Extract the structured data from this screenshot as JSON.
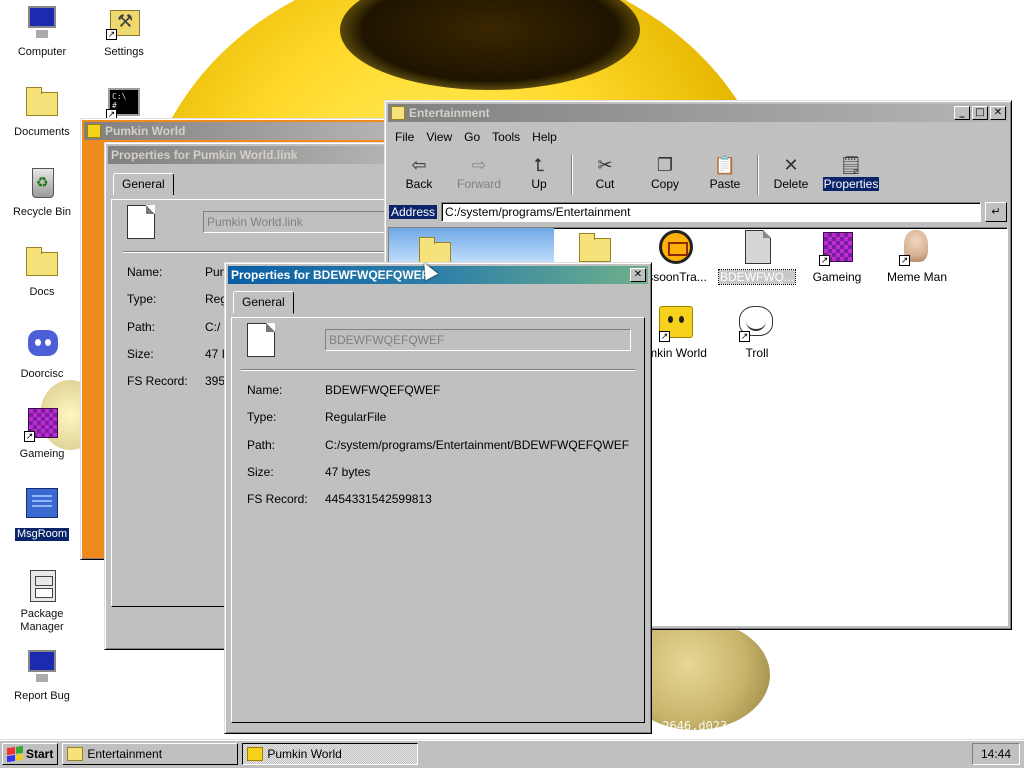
{
  "desktop": {
    "icons": [
      {
        "label": "Computer",
        "icon": "computer-icon"
      },
      {
        "label": "Settings",
        "icon": "settings-icon"
      },
      {
        "label": "Documents",
        "icon": "documents-folder-icon"
      },
      {
        "label": "Recycle Bin",
        "icon": "recycle-bin-icon"
      },
      {
        "label": "Docs",
        "icon": "folder-icon"
      },
      {
        "label": "Doorcisc",
        "icon": "discord-icon"
      },
      {
        "label": "Gameing",
        "icon": "purple-cube-icon"
      },
      {
        "label": "MsgRoom",
        "icon": "msgroom-icon"
      },
      {
        "label": "Package Manager",
        "icon": "package-manager-icon"
      },
      {
        "label": "Report Bug",
        "icon": "report-bug-icon"
      }
    ],
    "version_text": ".2646.d023"
  },
  "pumkin_window": {
    "title": "Pumkin World"
  },
  "pumkin_props": {
    "title": "Properties for Pumkin World.link",
    "tab": "General",
    "name_value": "Pumkin World.link",
    "labels": [
      "Name:",
      "Type:",
      "Path:",
      "Size:",
      "FS Record:"
    ],
    "values": [
      "Pun",
      "Reg",
      "C:/",
      "47 I",
      "395"
    ]
  },
  "explorer": {
    "title": "Entertainment",
    "menu": [
      "File",
      "View",
      "Go",
      "Tools",
      "Help"
    ],
    "toolbar": [
      {
        "label": "Back",
        "icon": "back-arrow-icon",
        "glyph": "⇦",
        "enabled": true
      },
      {
        "label": "Forward",
        "icon": "forward-arrow-icon",
        "glyph": "⇨",
        "enabled": false
      },
      {
        "label": "Up",
        "icon": "up-folder-icon",
        "glyph": "⮤",
        "enabled": true
      },
      {
        "label": "Cut",
        "icon": "scissors-icon",
        "glyph": "✂",
        "enabled": true
      },
      {
        "label": "Copy",
        "icon": "copy-icon",
        "glyph": "❐",
        "enabled": true
      },
      {
        "label": "Paste",
        "icon": "paste-icon",
        "glyph": "📋",
        "enabled": true
      },
      {
        "label": "Delete",
        "icon": "delete-x-icon",
        "glyph": "✕",
        "enabled": true
      },
      {
        "label": "Properties",
        "icon": "properties-icon",
        "glyph": "🗒",
        "enabled": true
      }
    ],
    "address_label": "Address",
    "address_value": "C:/system/programs/Entertainment",
    "files": [
      {
        "label": "",
        "icon": "folder-icon"
      },
      {
        "label": "",
        "icon": "folder-icon"
      },
      {
        "label": "ssoonTra...",
        "icon": "trash-app-icon"
      },
      {
        "label": "BDEWFWQ...",
        "icon": "file-icon"
      },
      {
        "label": "Gameing",
        "icon": "purple-cube-icon"
      },
      {
        "label": "Meme Man",
        "icon": "meme-man-icon"
      },
      {
        "label": "mkin World",
        "icon": "pumpkin-icon"
      },
      {
        "label": "Troll",
        "icon": "troll-face-icon"
      }
    ]
  },
  "bdew_props": {
    "title": "Properties for BDEWFWQEFQWEF",
    "tab": "General",
    "name_value": "BDEWFWQEFQWEF",
    "labels": [
      "Name:",
      "Type:",
      "Path:",
      "Size:",
      "FS Record:"
    ],
    "values": [
      "BDEWFWQEFQWEF",
      "RegularFile",
      "C:/system/programs/Entertainment/BDEWFWQEFQWEF",
      "47 bytes",
      "4454331542599813"
    ]
  },
  "taskbar": {
    "start": "Start",
    "buttons": [
      "Entertainment",
      "Pumkin World"
    ],
    "clock": "14:44"
  },
  "colors": {
    "active_title_start": "#0a5ea6",
    "active_title_end": "#6fb08a",
    "selection": "#0a246a",
    "orange_accent": "#f08a1c"
  }
}
